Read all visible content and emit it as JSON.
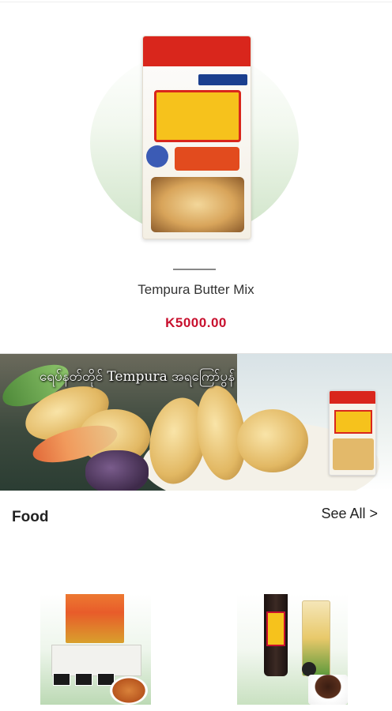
{
  "featured_product": {
    "image": "tempura-butter-mix-package",
    "name": "Tempura Butter Mix",
    "price": "K5000.00"
  },
  "banner": {
    "text": "ရေပ်နတ်တိုင် Tempura အရကြော်ပွန်"
  },
  "food_section": {
    "title": "Food",
    "see_all_label": "See All >",
    "products": [
      {
        "image": "yakisoba-noodle-pack"
      },
      {
        "image": "tsuyu-soy-sauce-bottle"
      }
    ]
  },
  "colors": {
    "price": "#c8102e",
    "package_red": "#d9261c",
    "package_yellow": "#f6c21c"
  }
}
